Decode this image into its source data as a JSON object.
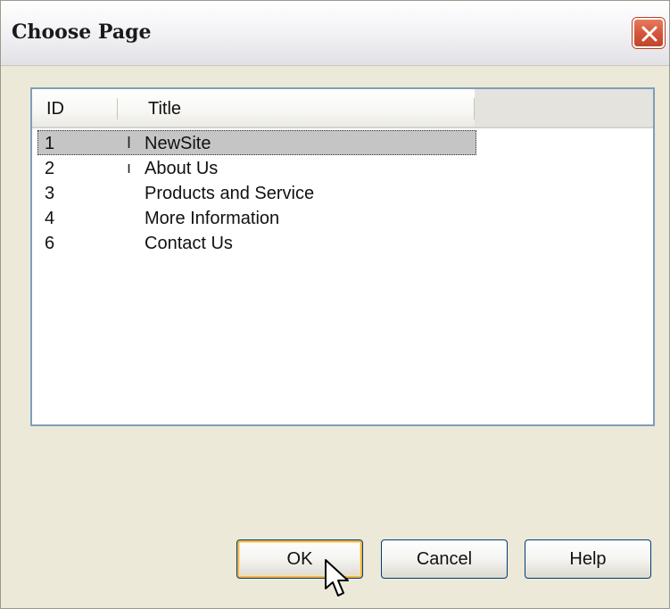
{
  "window": {
    "title": "Choose Page",
    "close_label": "✕"
  },
  "list": {
    "columns": [
      "ID",
      "Title"
    ],
    "rows": [
      {
        "id": "1",
        "title": "NewSite",
        "selected": true,
        "marker": "I"
      },
      {
        "id": "2",
        "title": "About Us",
        "selected": false,
        "marker": "ı"
      },
      {
        "id": "3",
        "title": "Products and Service",
        "selected": false,
        "marker": ""
      },
      {
        "id": "4",
        "title": "More Information",
        "selected": false,
        "marker": ""
      },
      {
        "id": "6",
        "title": "Contact Us",
        "selected": false,
        "marker": ""
      }
    ]
  },
  "buttons": {
    "ok": "OK",
    "cancel": "Cancel",
    "help": "Help"
  },
  "colors": {
    "dialog_bg": "#ece9d8",
    "close_red": "#d2543a",
    "selection_bg": "#c5c5c5",
    "default_button_border": "#f2b44a"
  },
  "icons": {
    "close": "close-icon",
    "cursor": "mouse-pointer-icon"
  }
}
